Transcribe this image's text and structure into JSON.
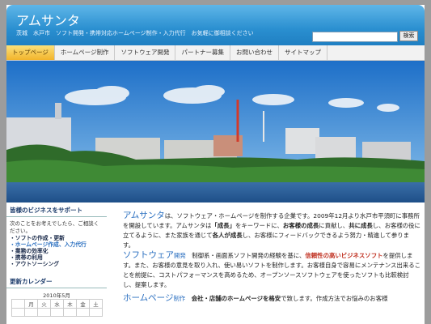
{
  "header": {
    "title": "アムサンタ",
    "tagline": "茨城　水戸市　ソフト開発・携帯対応ホームページ制作・入力代行　お気軽に御相談ください",
    "search_placeholder": "",
    "search_button": "検索"
  },
  "nav": {
    "items": [
      {
        "label": "トップページ",
        "active": true
      },
      {
        "label": "ホームページ制作",
        "active": false
      },
      {
        "label": "ソフトウェア開発",
        "active": false
      },
      {
        "label": "パートナー募集",
        "active": false
      },
      {
        "label": "お問い合わせ",
        "active": false
      },
      {
        "label": "サイトマップ",
        "active": false
      }
    ]
  },
  "sidebar": {
    "heading": "皆様のビジネスをサポート",
    "intro": "次のことをお考えでしたら、ご相談ください。",
    "list": [
      "・ソフトの作成・更新",
      "・ホームページ作成、入力代行",
      "・業務の効率化",
      "・携帯の利用",
      "・アウトソーシング"
    ],
    "calendar_heading": "更新カレンダー",
    "calendar_month": "2010年5月",
    "weekdays": [
      "",
      "月",
      "火",
      "水",
      "木",
      "金",
      "土"
    ]
  },
  "content": {
    "p1": {
      "brand": "アムサンタ",
      "t1": "は、ソフトウェア・ホームページを制作する企業です。2009年12月より水戸市平須町に事務所を開設しています。アムサンタは",
      "bold1": "「成長」",
      "t2": "をキーワードに、",
      "bold2": "お客様の成長",
      "t3": "に貢献し、",
      "bold3": "共に成長",
      "t4": "し、お客様の役に立てるように、また家族を通じて",
      "bold4": "各人が成長",
      "t5": "し、お客様にフィードバックできるよう努力・精進して参ります。"
    },
    "p2": {
      "brand": "ソフトウェア",
      "suffix": "開発",
      "t1": "　制御系・画面系ソフト開発の経験を基に、",
      "bold1": "信頼性の高いビジネスソフト",
      "t2": "を提供します。また、お客様の意見を取り入れ、使い易いソフトを制作します。お客様自身で容易にメンテナンス出来ることを前提に、コストパフォーマンスを高めるため、オープンソースソフトウェア",
      "t3": "を使ったソフトも比較検討し、提案します。"
    },
    "p3": {
      "brand": "ホームページ",
      "suffix": "制作",
      "t1": "　",
      "bold1": "会社・店舗のホームページを格安",
      "t2": "で致します。作成方法でお悩みのお客様"
    }
  },
  "colors": {
    "header": "#2a8fd0",
    "accent": "#2a6fc0",
    "nav_active": "#f2b42c"
  }
}
